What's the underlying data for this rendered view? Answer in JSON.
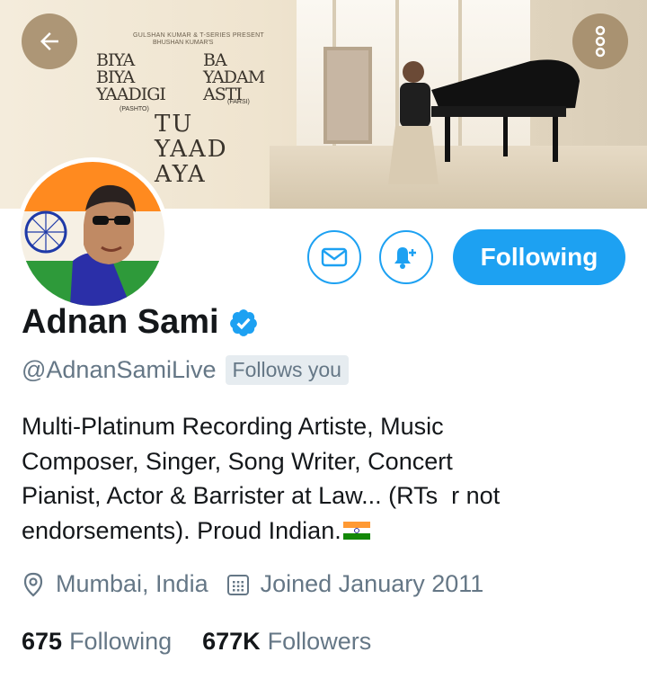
{
  "banner": {
    "credit_line1": "GULSHAN KUMAR & T-SERIES PRESENT",
    "credit_line2": "BHUSHAN KUMAR'S",
    "song1_title": [
      "BIYA",
      "BIYA",
      "YAADIGI"
    ],
    "song1_lang": "(PASHTO)",
    "song2_title": [
      "BA",
      "YADAM",
      "ASTI"
    ],
    "song2_lang": "(FARSI)",
    "song3_title": [
      "TU",
      "YAAD",
      "AYA"
    ]
  },
  "header": {
    "back_icon": "arrow-left-icon",
    "more_icon": "more-vertical-icon"
  },
  "actions": {
    "message_icon": "mail-icon",
    "notify_icon": "bell-plus-icon",
    "follow_label": "Following",
    "accent_color": "#1da1f2"
  },
  "profile": {
    "name": "Adnan Sami",
    "verified": true,
    "handle": "@AdnanSamiLive",
    "follows_you": "Follows you",
    "bio_lines": [
      "Multi-Platinum Recording Artiste, Music",
      "Composer, Singer, Song Writer, Concert",
      "Pianist, Actor & Barrister at Law... (RTs  r not",
      "endorsements). Proud Indian."
    ],
    "bio_emoji": "india-flag",
    "location": "Mumbai, India",
    "joined": "Joined January 2011"
  },
  "stats": {
    "following_count": "675",
    "following_label": "Following",
    "followers_count": "677K",
    "followers_label": "Followers"
  }
}
